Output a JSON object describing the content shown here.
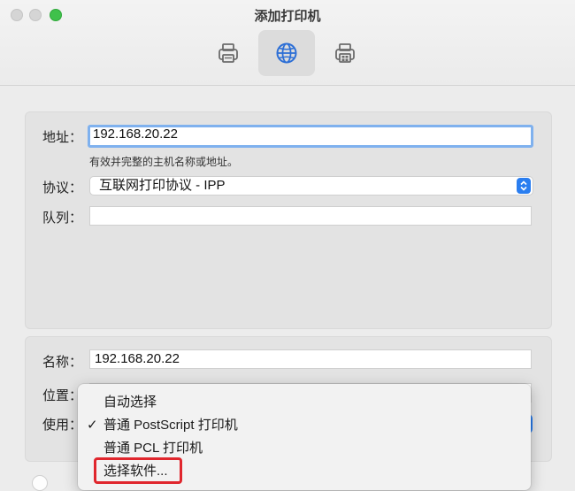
{
  "window": {
    "title": "添加打印机"
  },
  "toolbar": {
    "items": [
      {
        "icon": "printer-icon",
        "active": false
      },
      {
        "icon": "globe-icon",
        "active": true
      },
      {
        "icon": "printer-windows-icon",
        "active": false
      }
    ]
  },
  "ip_form": {
    "address_label": "地址：",
    "address_value": "192.168.20.22",
    "address_hint": "有效并完整的主机名称或地址。",
    "protocol_label": "协议：",
    "protocol_value": "互联网打印协议 - IPP",
    "queue_label": "队列：",
    "queue_value": ""
  },
  "info_form": {
    "name_label": "名称：",
    "name_value": "192.168.20.22",
    "location_label": "位置：",
    "use_label": "使用："
  },
  "driver_menu": {
    "items": [
      {
        "label": "自动选择",
        "checked": false
      },
      {
        "label": "普通 PostScript 打印机",
        "checked": true
      },
      {
        "label": "普通 PCL 打印机",
        "checked": false
      },
      {
        "label": "选择软件...",
        "checked": false
      }
    ],
    "check_glyph": "✓"
  },
  "colors": {
    "accent": "#2a7ef0",
    "focus_ring": "#7fb1ee",
    "annotation_red": "#e0262d"
  }
}
